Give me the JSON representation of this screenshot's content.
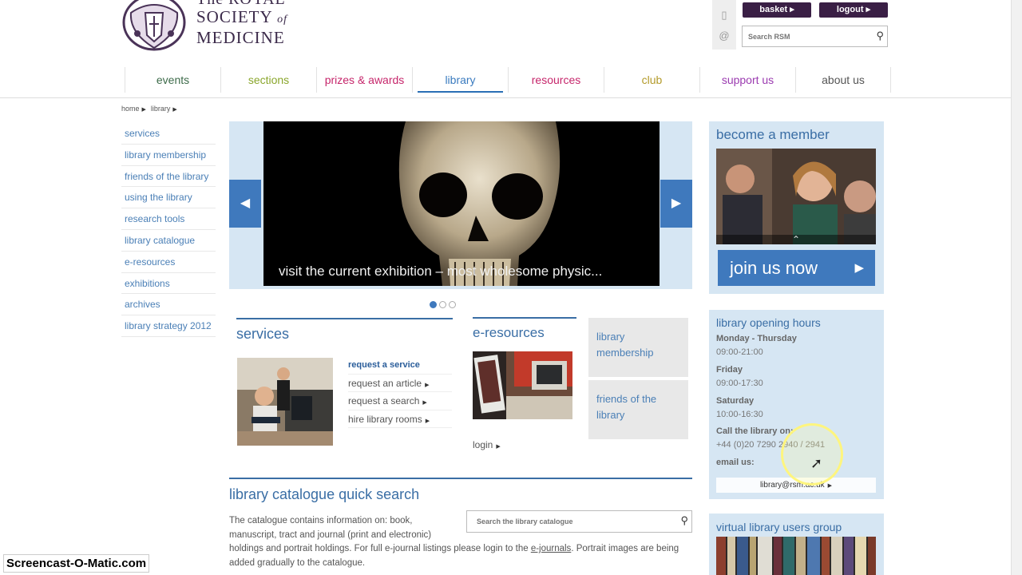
{
  "logo": {
    "line1": "The ROYAL",
    "line2": "SOCIETY",
    "of": "of",
    "line3": "MEDICINE"
  },
  "header": {
    "basket_label": "basket",
    "logout_label": "logout",
    "search_placeholder": "Search RSM"
  },
  "nav": [
    {
      "label": "events",
      "color": "#3d6b4a"
    },
    {
      "label": "sections",
      "color": "#8aa62c"
    },
    {
      "label": "prizes & awards",
      "color": "#c6266b"
    },
    {
      "label": "library",
      "color": "#3a7bbf"
    },
    {
      "label": "resources",
      "color": "#c6266b"
    },
    {
      "label": "club",
      "color": "#b39a2a"
    },
    {
      "label": "support us",
      "color": "#9b3bb0"
    },
    {
      "label": "about us",
      "color": "#555555"
    }
  ],
  "breadcrumb": [
    "home",
    "library"
  ],
  "leftmenu": [
    "services",
    "library membership",
    "friends of the library",
    "using the library",
    "research tools",
    "library catalogue",
    "e-resources",
    "exhibitions",
    "archives",
    "library strategy 2012"
  ],
  "slider": {
    "caption": "visit the current exhibition – most wholesome physic..."
  },
  "services": {
    "title": "services",
    "links": [
      "request a service",
      "request an article",
      "request a search",
      "hire library rooms"
    ]
  },
  "eresources": {
    "title": "e-resources",
    "login": "login"
  },
  "tiles": {
    "membership": "library membership",
    "friends": "friends of the library"
  },
  "quick_search": {
    "title": "library catalogue quick search",
    "text_1": "The catalogue contains information on: book, manuscript, tract and journal (print and electronic) holdings and portrait holdings. For full e-journal listings please login to the ",
    "link": "e-journals",
    "text_2": ". Portrait images are being added gradually to the catalogue.",
    "placeholder": "Search the library catalogue"
  },
  "member": {
    "title": "become a member",
    "join": "join us now"
  },
  "hours": {
    "title": "library opening hours",
    "rows": [
      {
        "label": "Monday - Thursday",
        "value": "09:00-21:00"
      },
      {
        "label": "Friday",
        "value": "09:00-17:30"
      },
      {
        "label": "Saturday",
        "value": "10:00-16:30"
      }
    ],
    "call_label": "Call the library on:",
    "phone": "+44 (0)20 7290 2940 / 2941",
    "email_label": "email us:",
    "email": "library@rsm.ac.uk"
  },
  "vlug": {
    "title": "virtual library users group"
  },
  "watermark": "Screencast-O-Matic.com"
}
